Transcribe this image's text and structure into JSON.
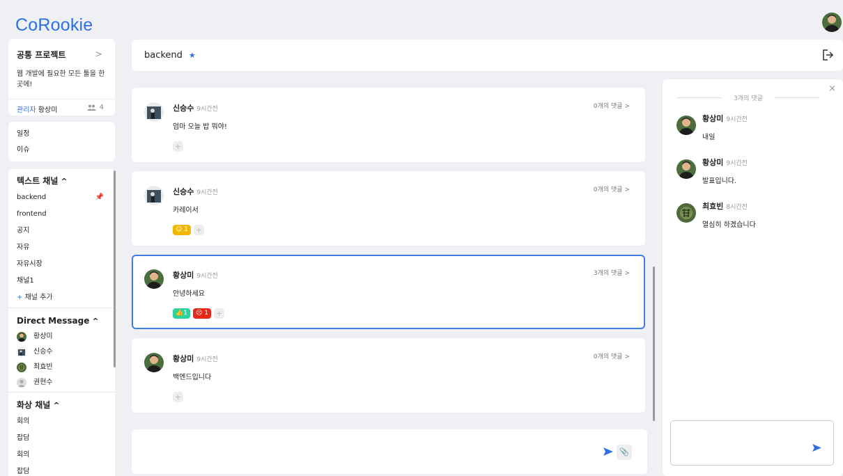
{
  "app": {
    "logo": "CoRookie"
  },
  "project": {
    "name": "공통 프로젝트",
    "description": "웹 개발에 필요한 모든 툴을 한 곳에!",
    "admin_label": "관리자",
    "admin_name": "황상미",
    "member_count": "4"
  },
  "menu": {
    "schedule": "일정",
    "issue": "이슈"
  },
  "text_channels": {
    "header": "텍스트 채널",
    "items": [
      "backend",
      "frontend",
      "공지",
      "자유",
      "자유시장",
      "채널1"
    ],
    "add_label": "채널 추가"
  },
  "direct_messages": {
    "header": "Direct Message",
    "users": [
      "황상미",
      "신승수",
      "최효빈",
      "권현수"
    ]
  },
  "video_channels": {
    "header": "화상 채널",
    "items": [
      "회의",
      "잡담",
      "회의",
      "잡담"
    ]
  },
  "channel": {
    "name": "backend"
  },
  "messages": [
    {
      "author": "신승수",
      "time": "9시간전",
      "text": "엄마 오늘 밥 뭐야!",
      "comments": "0개의 댓글"
    },
    {
      "author": "신승수",
      "time": "9시간전",
      "text": "카레이서",
      "comments": "0개의 댓글",
      "reactions": [
        "1"
      ]
    },
    {
      "author": "황상미",
      "time": "9시간전",
      "text": "안녕하세요",
      "comments": "3개의 댓글",
      "reactions": [
        "1",
        "1"
      ]
    },
    {
      "author": "황상미",
      "time": "9시간전",
      "text": "백엔드입니다",
      "comments": "0개의 댓글"
    }
  ],
  "thread": {
    "header": "3개의 댓글",
    "comments": [
      {
        "author": "황상미",
        "time": "9시간전",
        "text": "내일"
      },
      {
        "author": "황상미",
        "time": "9시간전",
        "text": "발표입니다."
      },
      {
        "author": "최효빈",
        "time": "8시간전",
        "text": "열심히 하겠습니다"
      }
    ]
  },
  "icons": {
    "pin": "pin-icon",
    "exit": "exit-icon",
    "send": "send-icon",
    "attach": "paperclip-icon",
    "close": "close-icon",
    "members": "people-icon",
    "chevron": "chevron-right-icon",
    "caret": "caret-up-icon"
  },
  "colors": {
    "accent": "#2f6fe4",
    "react_yellow": "#f2b705",
    "react_green": "#2ed39b",
    "react_red": "#e8271b",
    "selected_border": "#3d7be5"
  }
}
